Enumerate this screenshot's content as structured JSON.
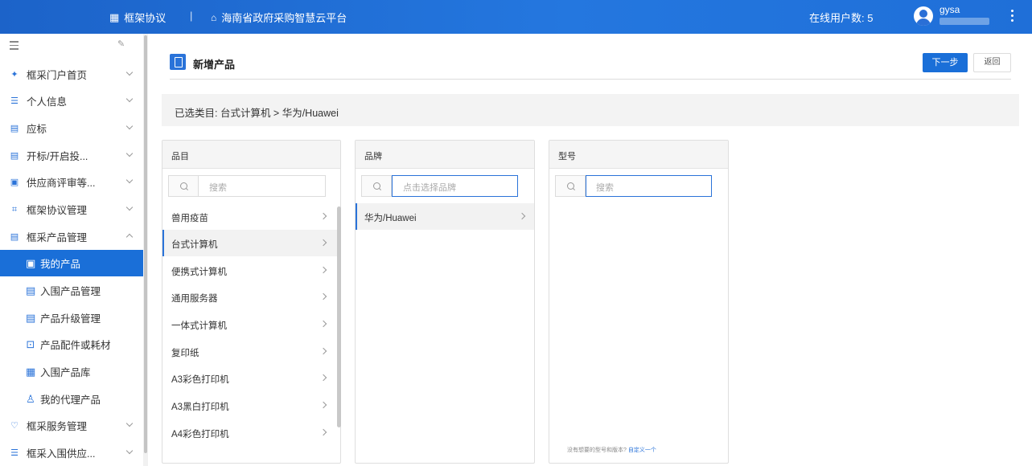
{
  "topbar": {
    "brand": "框架协议",
    "separator": "|",
    "platform": "海南省政府采购智慧云平台",
    "online_users": "在线用户数: 5",
    "username": "gysa"
  },
  "sidebar": {
    "items": [
      {
        "label": "框采门户首页",
        "icon": "grid-icon"
      },
      {
        "label": "个人信息",
        "icon": "id-card-icon"
      },
      {
        "label": "应标",
        "icon": "doc-icon"
      },
      {
        "label": "开标/开启投...",
        "icon": "doc-icon"
      },
      {
        "label": "供应商评审等...",
        "icon": "review-icon"
      },
      {
        "label": "框架协议管理",
        "icon": "contract-icon"
      },
      {
        "label": "框采产品管理",
        "icon": "product-icon"
      }
    ],
    "sub_items": [
      {
        "label": "我的产品",
        "icon": "product-icon"
      },
      {
        "label": "入围产品管理",
        "icon": "product-icon"
      },
      {
        "label": "产品升级管理",
        "icon": "upgrade-icon"
      },
      {
        "label": "产品配件或耗材",
        "icon": "parts-icon"
      },
      {
        "label": "入围产品库",
        "icon": "grid-icon"
      },
      {
        "label": "我的代理产品",
        "icon": "user-icon"
      }
    ],
    "bottom_items": [
      {
        "label": "框采服务管理",
        "icon": "service-icon"
      },
      {
        "label": "框采入围供应...",
        "icon": "supplier-icon"
      }
    ]
  },
  "page": {
    "title": "新增产品",
    "next_label": "下一步",
    "back_label": "返回",
    "selected_category": "已选类目: 台式计算机 > 华为/Huawei"
  },
  "panels": {
    "category": {
      "header": "品目",
      "search_placeholder": "搜索",
      "items": [
        "兽用疫苗",
        "台式计算机",
        "便携式计算机",
        "通用服务器",
        "一体式计算机",
        "复印纸",
        "A3彩色打印机",
        "A3黑白打印机",
        "A4彩色打印机"
      ],
      "selected": "台式计算机"
    },
    "brand": {
      "header": "品牌",
      "search_placeholder": "点击选择品牌",
      "items": [
        "华为/Huawei"
      ],
      "selected": "华为/Huawei"
    },
    "model": {
      "header": "型号",
      "search_placeholder": "搜索",
      "note": "没有想要的型号和版本?",
      "note_link": "自定义一个"
    }
  }
}
